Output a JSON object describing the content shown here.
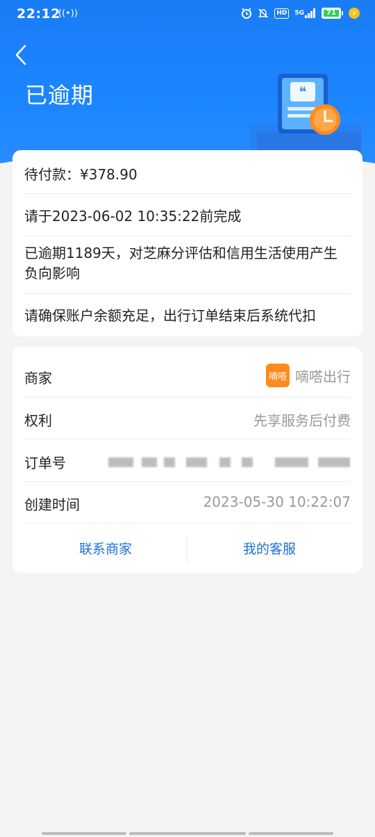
{
  "status_bar": {
    "time": "22:12",
    "battery": "71",
    "icons": [
      "hotspot-icon",
      "alarm-icon",
      "mute-icon",
      "hd-icon",
      "signal-5g-icon",
      "battery-icon",
      "charging-icon"
    ],
    "hd": "HD",
    "network": "5G"
  },
  "header": {
    "title": "已逾期",
    "accent": "#1c86ff"
  },
  "summary": {
    "pending_label": "待付款：",
    "pending_amount": "¥378.90",
    "deadline": "请于2023-06-02 10:35:22前完成",
    "overdue_notice": "已逾期1189天，对芝麻分评估和信用生活使用产生负向影响",
    "auto_deduct_notice": "请确保账户余额充足，出行订单结束后系统代扣"
  },
  "details": {
    "merchant_label": "商家",
    "merchant_logo_text": "嘀嗒",
    "merchant_name": "嘀嗒出行",
    "rights_label": "权利",
    "rights_value": "先享服务后付费",
    "order_label": "订单号",
    "created_label": "创建时间",
    "created_value": "2023-05-30 10:22:07"
  },
  "actions": {
    "contact_merchant": "联系商家",
    "customer_service": "我的客服"
  }
}
